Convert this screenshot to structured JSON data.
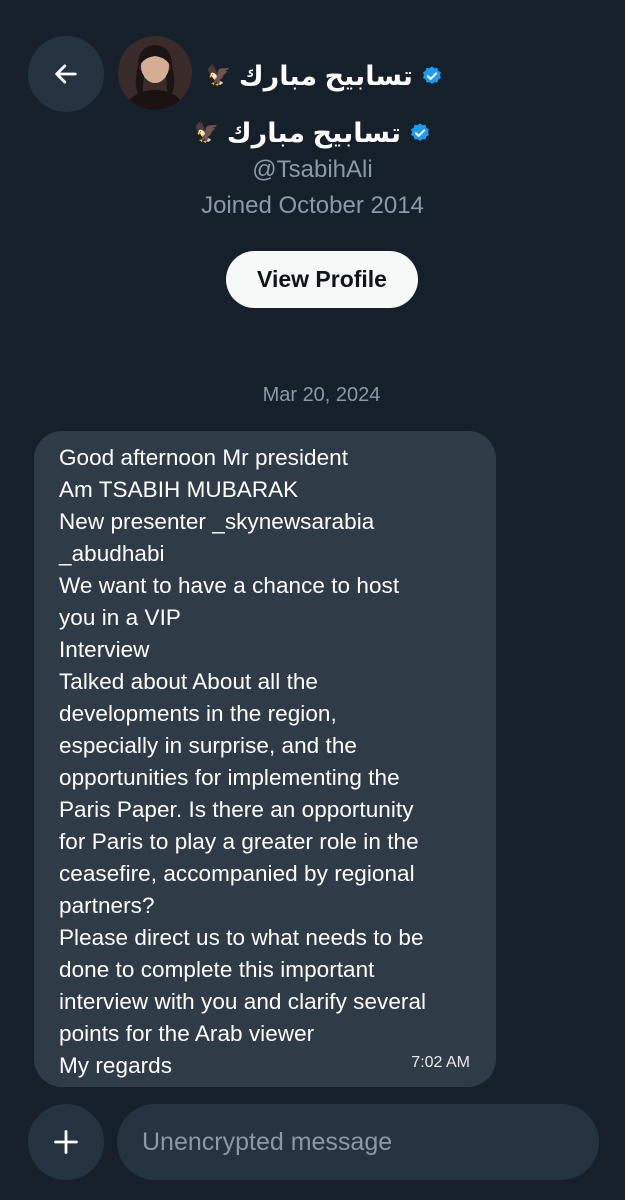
{
  "header": {
    "name": "تسابيح مبارك",
    "emoji": "🦅"
  },
  "profile": {
    "name": "تسابيح مبارك",
    "emoji": "🦅",
    "handle": "@TsabihAli",
    "joined": "Joined October 2014",
    "view_profile_label": "View Profile"
  },
  "conversation": {
    "date": "Mar 20, 2024",
    "message": {
      "text": "Good afternoon Mr president\nAm TSABIH MUBARAK\nNew presenter _skynewsarabia\n_abudhabi\nWe want to have a chance to host\nyou in a VIP\nInterview\nTalked about About all the\ndevelopments in the region,\nespecially in surprise, and the\nopportunities for implementing the\nParis Paper. Is there an opportunity\nfor Paris to play a greater role in the\nceasefire, accompanied by regional\npartners?\nPlease direct us to what needs to be\ndone to complete this important\ninterview with you and clarify several\npoints for the Arab viewer\nMy regards",
      "time": "7:02 AM"
    }
  },
  "composer": {
    "placeholder": "Unencrypted message"
  },
  "colors": {
    "background": "#15202b",
    "bubble": "#2f3b47",
    "button_bg": "#253341",
    "verified": "#1d9bf0",
    "secondary_text": "#8b98a5"
  },
  "icons": {
    "back": "arrow-left-icon",
    "verified": "verified-badge-icon",
    "add": "plus-icon"
  }
}
